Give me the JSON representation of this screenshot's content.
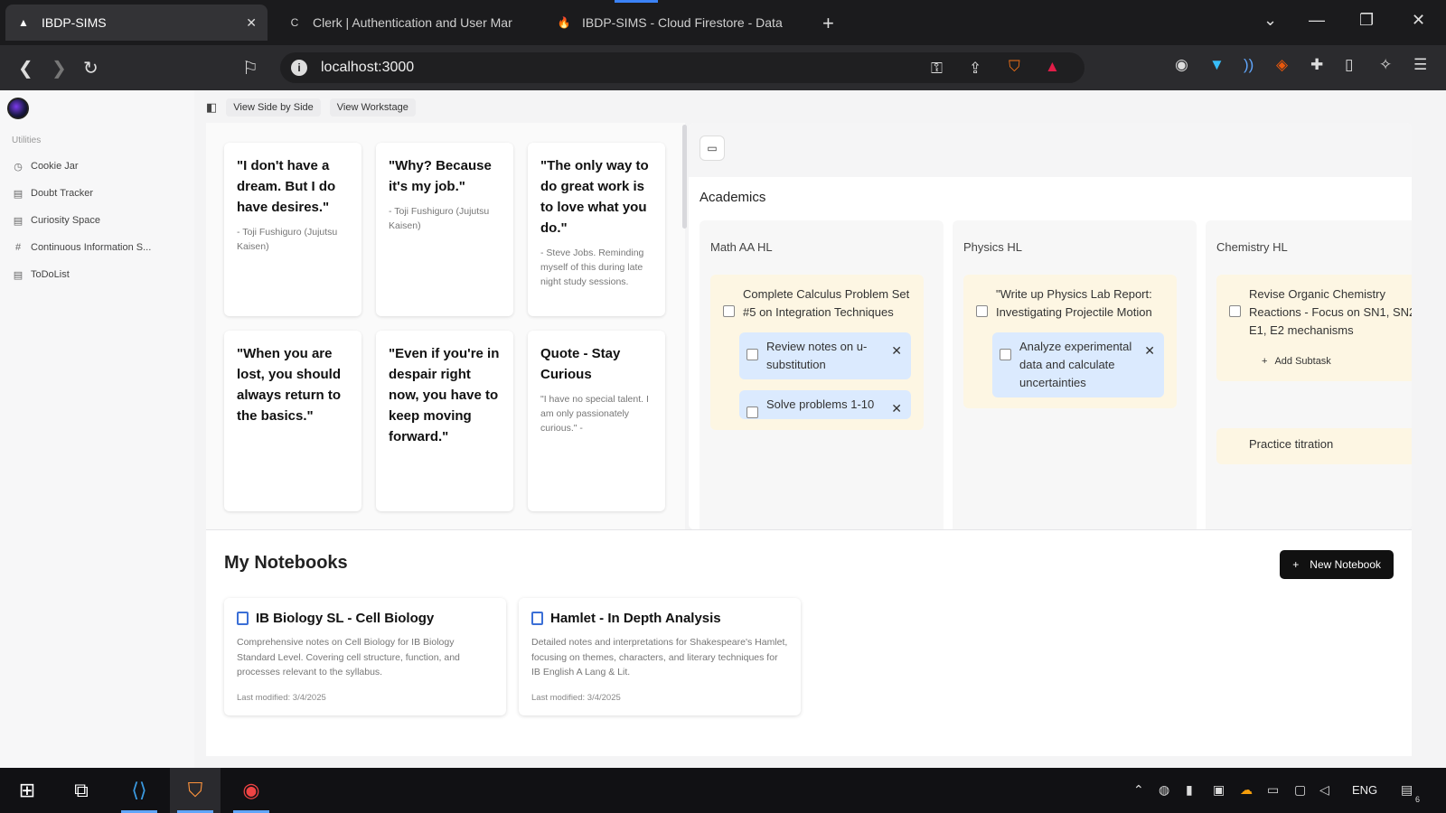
{
  "browser": {
    "tabs": [
      {
        "title": "IBDP-SIMS",
        "active": true
      },
      {
        "title": "Clerk | Authentication and User Mar",
        "active": false
      },
      {
        "title": "IBDP-SIMS - Cloud Firestore - Data",
        "active": false
      }
    ],
    "url": "localhost:3000",
    "new_tab": "+",
    "close": "✕"
  },
  "sidebar": {
    "section": "Utilities",
    "items": [
      {
        "label": "Cookie Jar",
        "icon": "clock-icon"
      },
      {
        "label": "Doubt Tracker",
        "icon": "book-icon"
      },
      {
        "label": "Curiosity Space",
        "icon": "book-icon"
      },
      {
        "label": "Continuous Information S...",
        "icon": "hash-icon"
      },
      {
        "label": "ToDoList",
        "icon": "book-icon"
      }
    ]
  },
  "toolbar": {
    "side_by_side": "View Side by Side",
    "workstage": "View Workstage"
  },
  "quotes": [
    {
      "text": "\"I don't have a dream. But I do have desires.\"",
      "source": "- Toji Fushiguro (Jujutsu Kaisen)"
    },
    {
      "text": "\"Why? Because it's my job.\"",
      "source": "- Toji Fushiguro (Jujutsu Kaisen)"
    },
    {
      "text": "\"The only way to do great work is to love what you do.\"",
      "source": "- Steve Jobs. Reminding myself of this during late night study sessions."
    },
    {
      "text": "\"When you are lost, you should always return to the basics.\"",
      "source": ""
    },
    {
      "text": "\"Even if you're in despair right now, you have to keep moving forward.\"",
      "source": ""
    },
    {
      "text": "Quote - Stay Curious",
      "source": "\"I have no special talent. I am only passionately curious.\" -"
    }
  ],
  "board": {
    "title": "Academics",
    "columns": [
      {
        "title": "Math AA HL",
        "task": "Complete Calculus Problem Set #5 on Integration Techniques",
        "subtasks": [
          "Review notes on u-substitution",
          "Solve problems 1-10"
        ]
      },
      {
        "title": "Physics HL",
        "task": "\"Write up Physics Lab Report: Investigating Projectile Motion",
        "subtasks": [
          "Analyze experimental data and calculate uncertainties"
        ]
      },
      {
        "title": "Chemistry HL",
        "task": "Revise Organic Chemistry Reactions - Focus on SN1, SN2, E1, E2 mechanisms",
        "add_subtask": "Add Subtask",
        "next_task": "Practice titration"
      }
    ]
  },
  "notebooks": {
    "title": "My Notebooks",
    "new_button": "New Notebook",
    "items": [
      {
        "title": "IB Biology SL - Cell Biology",
        "description": "Comprehensive notes on Cell Biology for IB Biology Standard Level. Covering cell structure, function, and processes relevant to the syllabus.",
        "modified": "Last modified: 3/4/2025"
      },
      {
        "title": "Hamlet - In Depth Analysis",
        "description": "Detailed notes and interpretations for Shakespeare's Hamlet, focusing on themes, characters, and literary techniques for IB English A Lang & Lit.",
        "modified": "Last modified: 3/4/2025"
      }
    ]
  },
  "taskbar": {
    "lang": "ENG",
    "notification_count": "6"
  },
  "colors": {
    "accent": "#3b6fd6",
    "task_bg": "#fdf6e3",
    "subtask_bg": "#dbeafe"
  }
}
